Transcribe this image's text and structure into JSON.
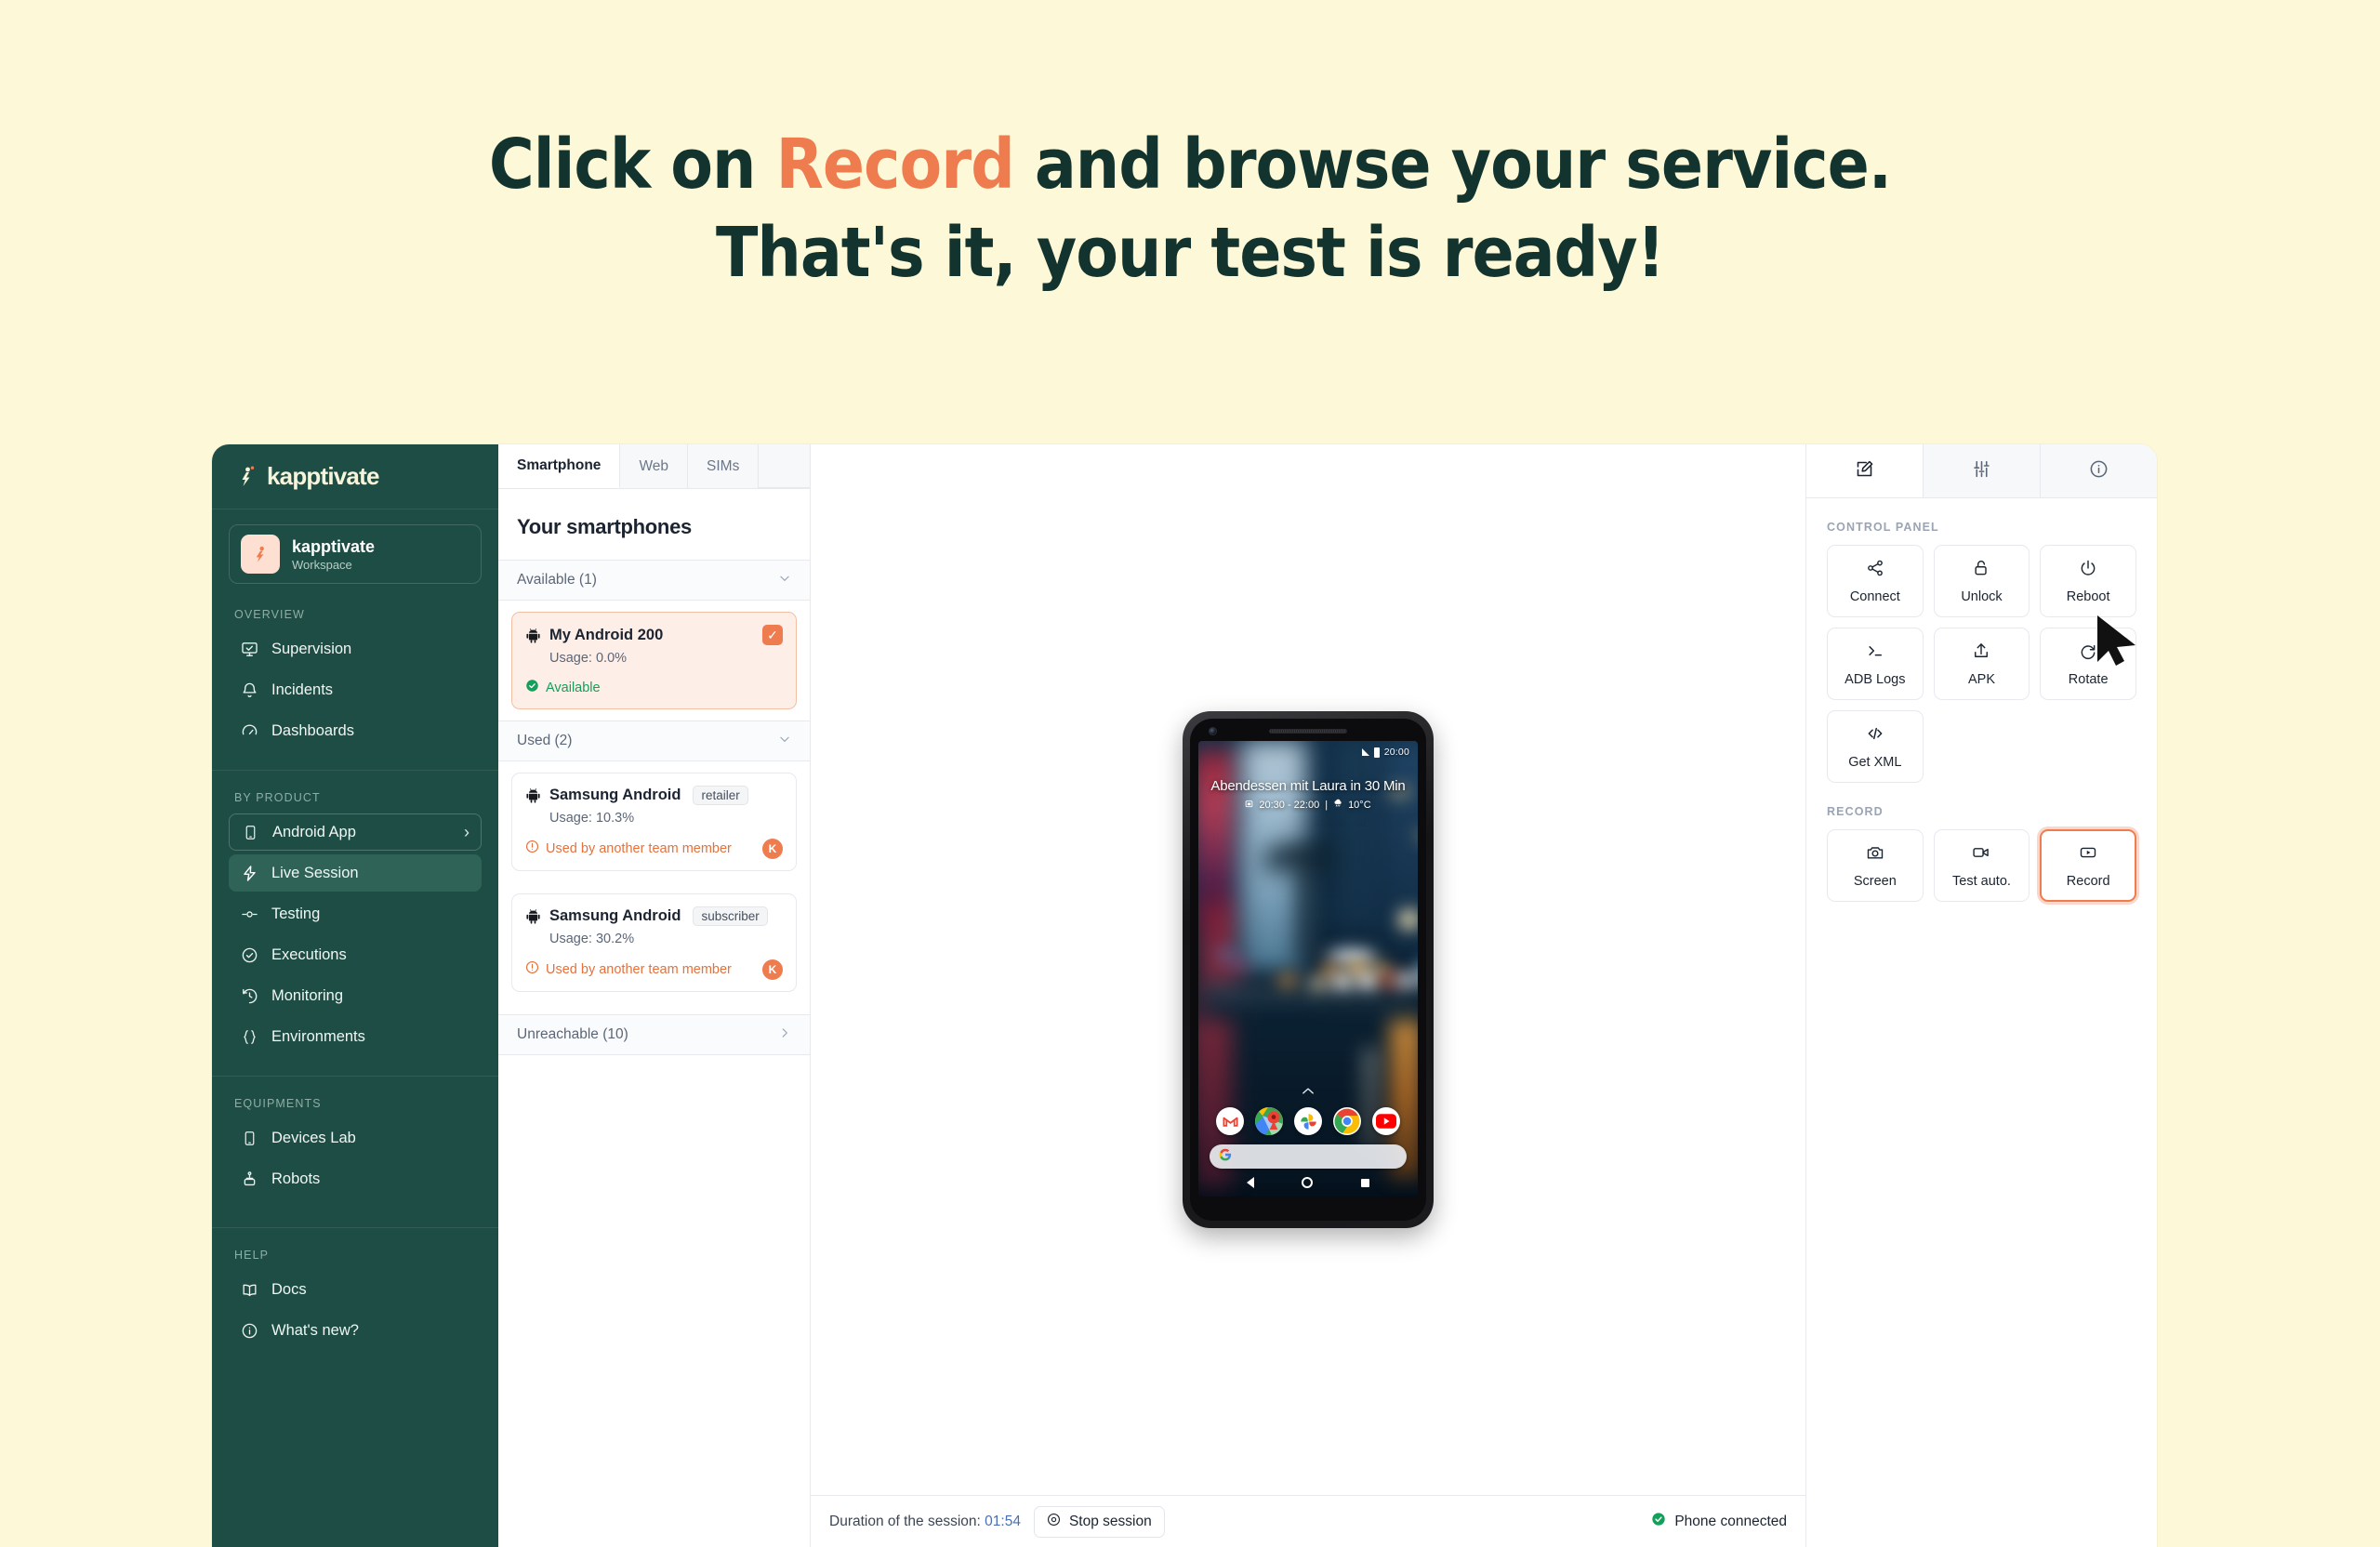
{
  "headline": {
    "line1_before": "Click on ",
    "line1_accent": "Record",
    "line1_after": " and browse your service.",
    "line2": "That's it, your test is ready!",
    "accent_color": "#ef7c4f",
    "text_color": "#13342e",
    "background_color": "#fdf8d7"
  },
  "sidebar": {
    "brand": "kapptivate",
    "workspace": {
      "name": "kapptivate",
      "subtitle": "Workspace",
      "avatar_initial": "k"
    },
    "sections": [
      {
        "label": "OVERVIEW",
        "items": [
          {
            "label": "Supervision",
            "icon": "monitor-check-icon"
          },
          {
            "label": "Incidents",
            "icon": "bell-icon"
          },
          {
            "label": "Dashboards",
            "icon": "gauge-icon"
          }
        ]
      },
      {
        "label": "BY PRODUCT",
        "items": [
          {
            "label": "Android App",
            "icon": "smartphone-icon",
            "boxed": true,
            "chevron": "›"
          },
          {
            "label": "Live Session",
            "icon": "bolt-icon",
            "active": true
          },
          {
            "label": "Testing",
            "icon": "node-icon"
          },
          {
            "label": "Executions",
            "icon": "check-circle-icon"
          },
          {
            "label": "Monitoring",
            "icon": "history-icon"
          },
          {
            "label": "Environments",
            "icon": "braces-icon"
          }
        ]
      },
      {
        "label": "EQUIPMENTS",
        "items": [
          {
            "label": "Devices Lab",
            "icon": "smartphone-icon"
          },
          {
            "label": "Robots",
            "icon": "robot-icon"
          }
        ]
      },
      {
        "label": "HELP",
        "items": [
          {
            "label": "Docs",
            "icon": "book-icon"
          },
          {
            "label": "What's new?",
            "icon": "info-circle-icon"
          }
        ]
      }
    ],
    "background_color": "#1d4d44",
    "active_item_color": "#2f6358"
  },
  "devices_panel": {
    "tabs": [
      {
        "label": "Smartphone",
        "active": true
      },
      {
        "label": "Web",
        "active": false
      },
      {
        "label": "SIMs",
        "active": false
      }
    ],
    "title": "Your smartphones",
    "groups": [
      {
        "header": "Available (1)",
        "chevron": "⌄",
        "expanded": true,
        "devices": [
          {
            "name": "My Android 200",
            "tag": null,
            "usage": "Usage: 0.0%",
            "status": "Available",
            "status_type": "available",
            "selected": true,
            "checkmark": "✓",
            "avatar": null
          }
        ]
      },
      {
        "header": "Used (2)",
        "chevron": "⌄",
        "expanded": true,
        "devices": [
          {
            "name": "Samsung Android",
            "tag": "retailer",
            "usage": "Usage: 10.3%",
            "status": "Used by another team member",
            "status_type": "used",
            "selected": false,
            "avatar": "K"
          },
          {
            "name": "Samsung Android",
            "tag": "subscriber",
            "usage": "Usage: 30.2%",
            "status": "Used by another team member",
            "status_type": "used",
            "selected": false,
            "avatar": "K"
          }
        ]
      },
      {
        "header": "Unreachable (10)",
        "chevron": "›",
        "expanded": false,
        "devices": []
      }
    ]
  },
  "phone": {
    "status_time": "20:00",
    "widget_title": "Abendessen mit Laura in 30 Min",
    "widget_time": "20:30 - 22:00",
    "widget_separator": "|",
    "widget_temp": "10°C",
    "dock_apps": [
      "gmail-icon",
      "maps-icon",
      "photos-icon",
      "chrome-icon",
      "youtube-icon"
    ],
    "search_icon": "google-g-icon",
    "nav_buttons": [
      "back-icon",
      "home-icon",
      "recents-icon"
    ],
    "drawer_arrow": "chevron-up-icon"
  },
  "status_bar": {
    "duration_label": "Duration of the session:",
    "duration_value": "01:54",
    "stop_button": "Stop session",
    "stop_icon": "stop-circle-icon",
    "connection_status": "Phone connected",
    "connection_icon": "check-circle-icon",
    "connection_color": "#13a05a"
  },
  "right_panel": {
    "tabs": [
      {
        "icon": "edit-square-icon",
        "active": true
      },
      {
        "icon": "sliders-icon",
        "active": false
      },
      {
        "icon": "info-circle-icon",
        "active": false
      }
    ],
    "sections": [
      {
        "label": "CONTROL PANEL",
        "buttons": [
          {
            "label": "Connect",
            "icon": "share-icon"
          },
          {
            "label": "Unlock",
            "icon": "unlock-icon"
          },
          {
            "label": "Reboot",
            "icon": "power-icon"
          },
          {
            "label": "ADB Logs",
            "icon": "terminal-icon"
          },
          {
            "label": "APK",
            "icon": "upload-icon"
          },
          {
            "label": "Rotate",
            "icon": "rotate-icon"
          },
          {
            "label": "Get XML",
            "icon": "code-icon"
          }
        ]
      },
      {
        "label": "RECORD",
        "buttons": [
          {
            "label": "Screen",
            "icon": "camera-icon"
          },
          {
            "label": "Test auto.",
            "icon": "video-icon"
          },
          {
            "label": "Record",
            "icon": "play-box-icon",
            "highlighted": true
          }
        ]
      }
    ],
    "highlight_color": "#ef7c4f"
  },
  "cursor": {
    "icon": "mouse-pointer-icon"
  }
}
